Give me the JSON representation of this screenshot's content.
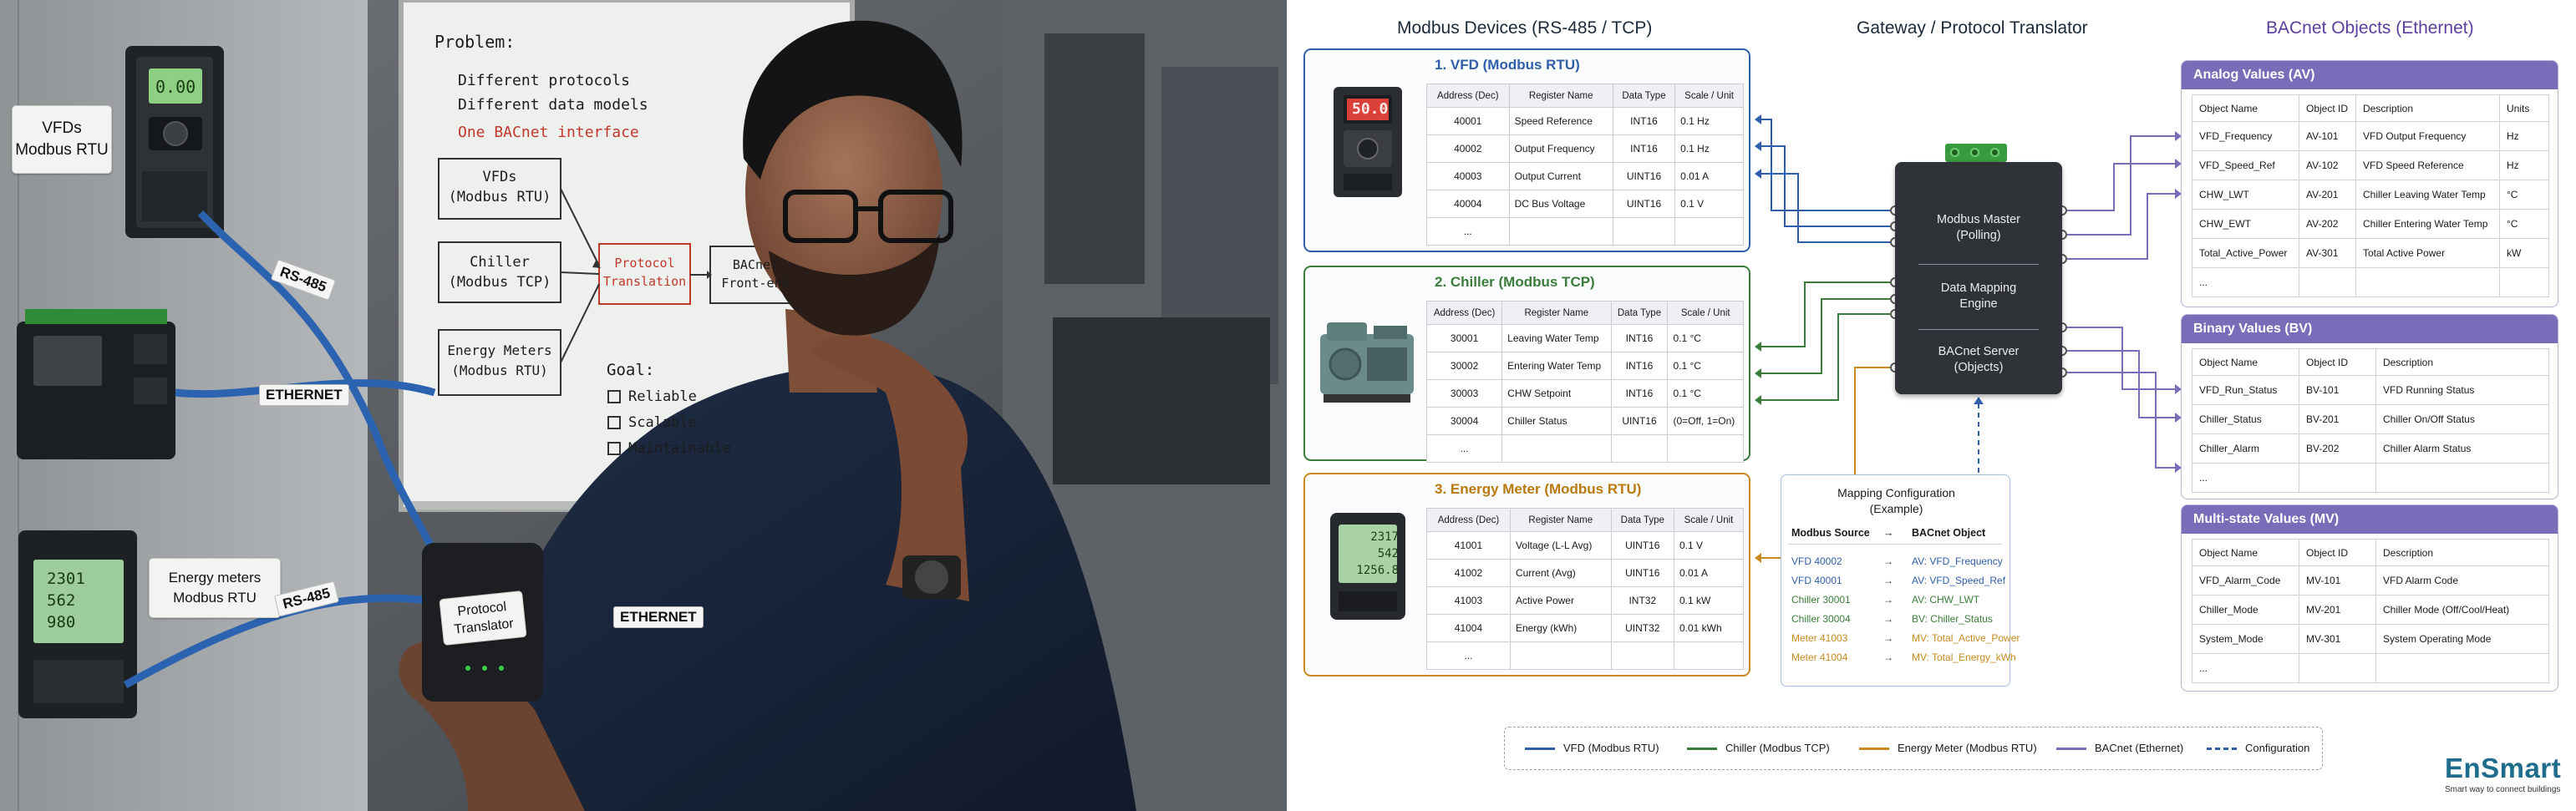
{
  "photo": {
    "whiteboard": {
      "problem_heading": "Problem:",
      "problem_items": [
        "Different protocols",
        "Different data models",
        "One BACnet interface"
      ],
      "nodes": {
        "vfds": [
          "VFDs",
          "(Modbus RTU)"
        ],
        "chiller": [
          "Chiller",
          "(Modbus TCP)"
        ],
        "meters": [
          "Energy Meters",
          "(Modbus RTU)"
        ],
        "translator": [
          "Protocol",
          "Translation"
        ],
        "bacnet": [
          "BACnet",
          "Front-end"
        ]
      },
      "goal_heading": "Goal:",
      "goal_items": [
        "Reliable",
        "Scalable",
        "Maintainable"
      ]
    },
    "labels": {
      "vfds": [
        "VFDs",
        "Modbus RTU"
      ],
      "energy_meters": [
        "Energy meters",
        "Modbus RTU"
      ],
      "translator": [
        "Protocol",
        "Translator"
      ]
    },
    "cable_tags": {
      "rs485_top": "RS-485",
      "ethernet_top": "ETHERNET",
      "rs485_bottom": "RS-485",
      "ethernet_bottom": "ETHERNET"
    },
    "device_displays": {
      "vfd": "0.00",
      "meter": [
        "2301",
        "562",
        "980"
      ]
    }
  },
  "columns": {
    "modbus": "Modbus Devices (RS-485 / TCP)",
    "gateway": "Gateway / Protocol Translator",
    "bacnet": "BACnet Objects (Ethernet)"
  },
  "register_headers": [
    "Address (Dec)",
    "Register Name",
    "Data Type",
    "Scale / Unit"
  ],
  "devices": [
    {
      "title": "1. VFD (Modbus RTU)",
      "color": "#2e5fa8",
      "display": "50.0",
      "rows": [
        [
          "40001",
          "Speed Reference",
          "INT16",
          "0.1 Hz"
        ],
        [
          "40002",
          "Output Frequency",
          "INT16",
          "0.1 Hz"
        ],
        [
          "40003",
          "Output Current",
          "UINT16",
          "0.01 A"
        ],
        [
          "40004",
          "DC Bus Voltage",
          "UINT16",
          "0.1 V"
        ],
        [
          "...",
          "",
          "",
          ""
        ]
      ]
    },
    {
      "title": "2. Chiller (Modbus TCP)",
      "color": "#3a7d3a",
      "rows": [
        [
          "30001",
          "Leaving Water Temp",
          "INT16",
          "0.1 °C"
        ],
        [
          "30002",
          "Entering Water Temp",
          "INT16",
          "0.1 °C"
        ],
        [
          "30003",
          "CHW Setpoint",
          "INT16",
          "0.1 °C"
        ],
        [
          "30004",
          "Chiller Status",
          "UINT16",
          "(0=Off, 1=On)"
        ],
        [
          "...",
          "",
          "",
          ""
        ]
      ]
    },
    {
      "title": "3. Energy Meter (Modbus RTU)",
      "color": "#c88a1e",
      "display": [
        "2317",
        "542",
        "1256.8"
      ],
      "rows": [
        [
          "41001",
          "Voltage (L-L Avg)",
          "UINT16",
          "0.1 V"
        ],
        [
          "41002",
          "Current (Avg)",
          "UINT16",
          "0.01 A"
        ],
        [
          "41003",
          "Active Power",
          "INT32",
          "0.1 kW"
        ],
        [
          "41004",
          "Energy (kWh)",
          "UINT32",
          "0.01 kWh"
        ],
        [
          "...",
          "",
          "",
          ""
        ]
      ]
    }
  ],
  "gateway": {
    "modbus_master": [
      "Modbus Master",
      "(Polling)"
    ],
    "mapping_engine": [
      "Data Mapping",
      "Engine"
    ],
    "bacnet_server": [
      "BACnet Server",
      "(Objects)"
    ]
  },
  "mapping": {
    "title": [
      "Mapping Configuration",
      "(Example)"
    ],
    "head_source": "Modbus Source",
    "head_object": "BACnet Object",
    "arrow": "→",
    "rows": [
      {
        "source": "VFD 40002",
        "object": "AV: VFD_Frequency",
        "color": "#2e5fa8"
      },
      {
        "source": "VFD 40001",
        "object": "AV: VFD_Speed_Ref",
        "color": "#2e5fa8"
      },
      {
        "source": "Chiller 30001",
        "object": "AV: CHW_LWT",
        "color": "#3a7d3a"
      },
      {
        "source": "Chiller 30004",
        "object": "BV: Chiller_Status",
        "color": "#3a7d3a"
      },
      {
        "source": "Meter 41003",
        "object": "MV: Total_Active_Power",
        "color": "#c88a1e"
      },
      {
        "source": "Meter 41004",
        "object": "MV: Total_Energy_kWh",
        "color": "#c88a1e"
      }
    ]
  },
  "bacnet_groups": [
    {
      "title": "Analog Values (AV)",
      "headers": [
        "Object Name",
        "Object ID",
        "Description",
        "Units"
      ],
      "rows": [
        [
          "VFD_Frequency",
          "AV-101",
          "VFD Output Frequency",
          "Hz"
        ],
        [
          "VFD_Speed_Ref",
          "AV-102",
          "VFD Speed Reference",
          "Hz"
        ],
        [
          "CHW_LWT",
          "AV-201",
          "Chiller Leaving Water Temp",
          "°C"
        ],
        [
          "CHW_EWT",
          "AV-202",
          "Chiller Entering Water Temp",
          "°C"
        ],
        [
          "Total_Active_Power",
          "AV-301",
          "Total Active Power",
          "kW"
        ],
        [
          "...",
          "",
          "",
          ""
        ]
      ]
    },
    {
      "title": "Binary Values (BV)",
      "headers": [
        "Object Name",
        "Object ID",
        "Description"
      ],
      "rows": [
        [
          "VFD_Run_Status",
          "BV-101",
          "VFD Running Status"
        ],
        [
          "Chiller_Status",
          "BV-201",
          "Chiller On/Off Status"
        ],
        [
          "Chiller_Alarm",
          "BV-202",
          "Chiller Alarm Status"
        ],
        [
          "...",
          "",
          ""
        ]
      ]
    },
    {
      "title": "Multi-state Values (MV)",
      "headers": [
        "Object Name",
        "Object ID",
        "Description"
      ],
      "rows": [
        [
          "VFD_Alarm_Code",
          "MV-101",
          "VFD Alarm Code"
        ],
        [
          "Chiller_Mode",
          "MV-201",
          "Chiller Mode (Off/Cool/Heat)"
        ],
        [
          "System_Mode",
          "MV-301",
          "System Operating Mode"
        ],
        [
          "...",
          "",
          ""
        ]
      ]
    }
  ],
  "legend": [
    {
      "label": "VFD (Modbus RTU)",
      "color": "#2e5fa8",
      "style": "solid"
    },
    {
      "label": "Chiller (Modbus TCP)",
      "color": "#3a7d3a",
      "style": "solid"
    },
    {
      "label": "Energy Meter (Modbus RTU)",
      "color": "#c88a1e",
      "style": "solid"
    },
    {
      "label": "BACnet (Ethernet)",
      "color": "#7a6cb8",
      "style": "solid"
    },
    {
      "label": "Configuration",
      "color": "#2e5fa8",
      "style": "dashed"
    }
  ],
  "logo": {
    "name": "EnSmart",
    "tagline": "Smart way to connect buildings"
  }
}
